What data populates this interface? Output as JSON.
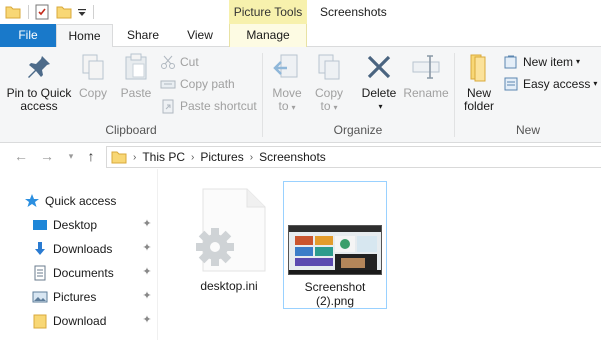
{
  "window": {
    "title": "Screenshots",
    "context_tools_label": "Picture Tools"
  },
  "qat": {
    "icons": [
      "folder-icon",
      "properties-icon",
      "new-folder-icon",
      "customize-qat-icon"
    ]
  },
  "tabs": {
    "file": "File",
    "home": "Home",
    "share": "Share",
    "view": "View",
    "manage": "Manage"
  },
  "ribbon": {
    "clipboard": {
      "label": "Clipboard",
      "pin_line1": "Pin to Quick",
      "pin_line2": "access",
      "copy": "Copy",
      "paste": "Paste",
      "cut": "Cut",
      "copy_path": "Copy path",
      "paste_shortcut": "Paste shortcut"
    },
    "organize": {
      "label": "Organize",
      "move_line1": "Move",
      "move_line2": "to",
      "copy_line1": "Copy",
      "copy_line2": "to",
      "delete": "Delete",
      "rename": "Rename"
    },
    "new": {
      "label": "New",
      "new_folder_line1": "New",
      "new_folder_line2": "folder",
      "new_item": "New item",
      "easy_access": "Easy access"
    }
  },
  "address": {
    "crumbs": [
      "This PC",
      "Pictures",
      "Screenshots"
    ]
  },
  "navpane": {
    "quick_access": "Quick access",
    "items": [
      {
        "label": "Desktop",
        "icon": "desktop-icon"
      },
      {
        "label": "Downloads",
        "icon": "download-arrow-icon"
      },
      {
        "label": "Documents",
        "icon": "documents-icon"
      },
      {
        "label": "Pictures",
        "icon": "pictures-icon"
      },
      {
        "label": "Download",
        "icon": "folder-icon"
      }
    ]
  },
  "files": [
    {
      "name": "desktop.ini",
      "icon": "settings-file-icon"
    },
    {
      "name_line1": "Screenshot",
      "name_line2": "(2).png",
      "icon": "image-thumbnail"
    }
  ],
  "colors": {
    "file_tab": "#1979ca",
    "context_tab": "#f7f1ad",
    "selection_border": "#99d1ff",
    "folder": "#f8d775"
  }
}
